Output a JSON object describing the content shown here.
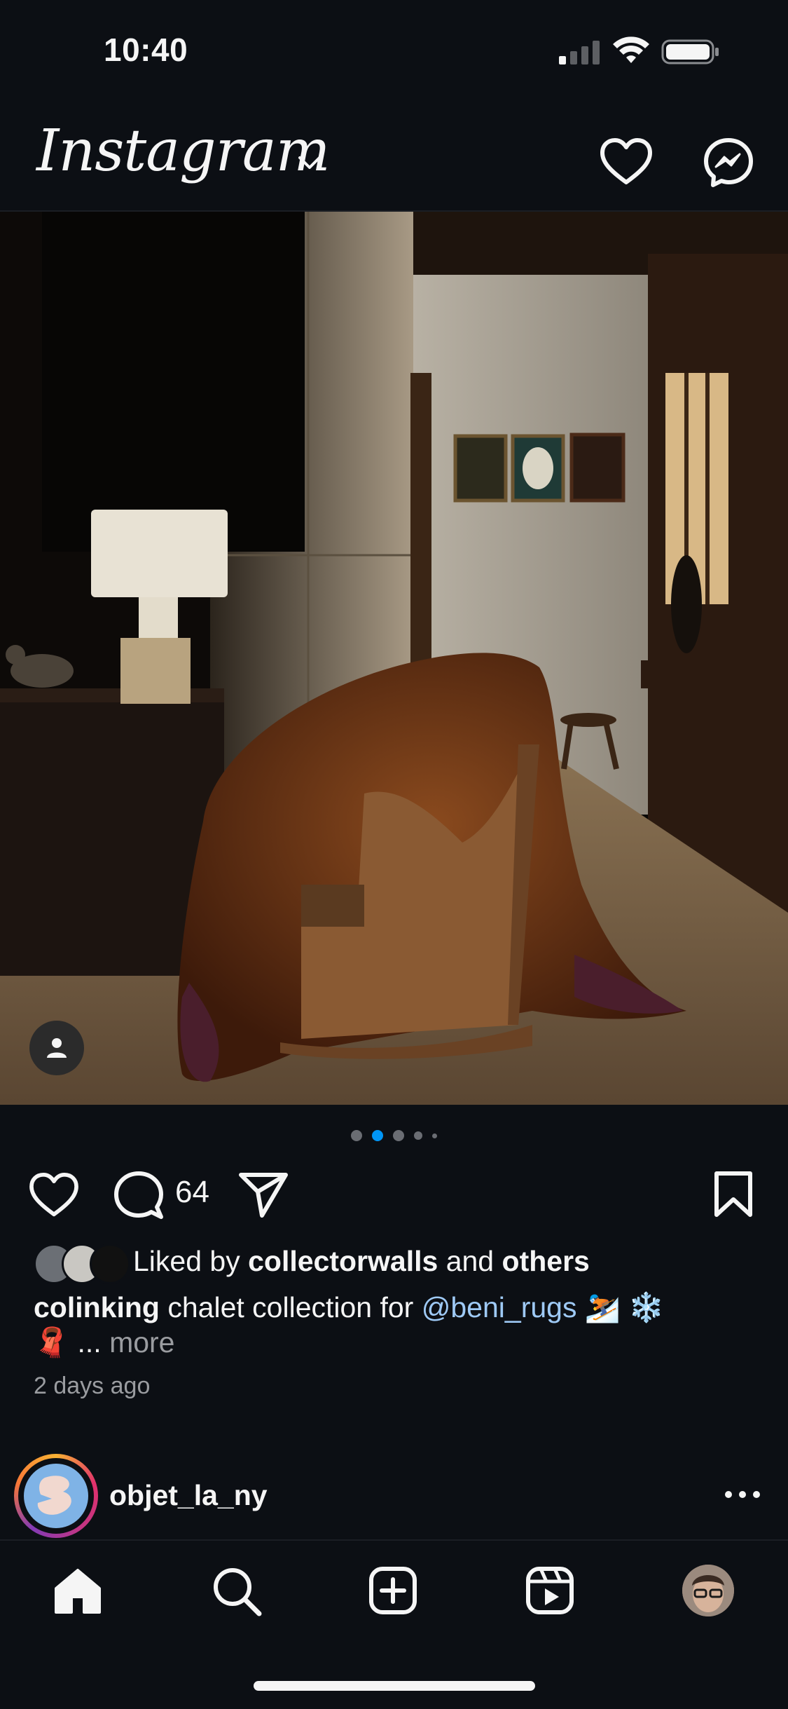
{
  "status_bar": {
    "time": "10:40",
    "icons": [
      "cellular-signal-icon",
      "wifi-icon",
      "battery-icon"
    ]
  },
  "header": {
    "logo_text": "Instagram",
    "icons": [
      "chevron-down-icon",
      "heart-icon",
      "messenger-icon"
    ]
  },
  "post": {
    "carousel": {
      "count": 5,
      "active_index": 1
    },
    "actions": {
      "comment_count": "64",
      "icons": [
        "like-icon",
        "comment-icon",
        "share-icon",
        "save-icon"
      ]
    },
    "likes": {
      "prefix": "Liked by",
      "user": "collectorwalls",
      "middle": "and",
      "others": "others"
    },
    "caption": {
      "username": "colinking",
      "text": "chalet collection for",
      "mention": "@beni_rugs",
      "emoji_line1": "⛷️ ❄️",
      "emoji_line2": "🧣",
      "ellipsis": "...",
      "more": "more"
    },
    "timestamp": "2 days ago"
  },
  "next_post": {
    "username": "objet_la_ny"
  },
  "tabbar": {
    "icons": [
      "home-icon",
      "search-icon",
      "create-icon",
      "reels-icon",
      "profile-avatar"
    ]
  },
  "colors": {
    "background": "#0c0f14",
    "accent_dot": "#0095f6",
    "mention": "#9ec9f5"
  }
}
